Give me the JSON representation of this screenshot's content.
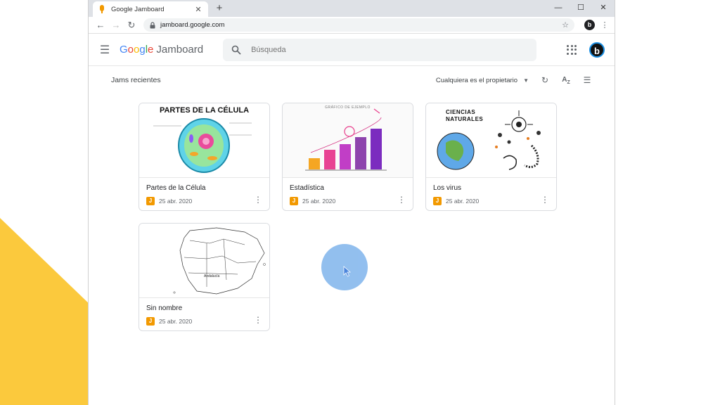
{
  "browser": {
    "tab_title": "Google Jamboard",
    "tab_close": "✕",
    "new_tab": "+",
    "url": "jamboard.google.com",
    "profile_initial": "b",
    "window_minimize": "—",
    "window_maximize": "☐",
    "window_close": "✕"
  },
  "header": {
    "logo_google": [
      "G",
      "o",
      "o",
      "g",
      "l",
      "e"
    ],
    "product": "Jamboard",
    "search_placeholder": "Búsqueda",
    "profile_initial": "b"
  },
  "toolbar": {
    "section_title": "Jams recientes",
    "owner_filter": "Cualquiera es el propietario"
  },
  "jams": [
    {
      "title": "Partes de la Célula",
      "date": "25 abr. 2020",
      "thumb_text": "PARTES DE LA CÉLULA"
    },
    {
      "title": "Estadística",
      "date": "25 abr. 2020",
      "thumb_text": "GRÁFICO DE EJEMPLO"
    },
    {
      "title": "Los virus",
      "date": "25 abr. 2020",
      "thumb_text": "CIENCIAS NATURALES"
    },
    {
      "title": "Sin nombre",
      "date": "25 abr. 2020",
      "thumb_text": "Andalucía"
    }
  ],
  "colors": {
    "accent_yellow": "#fbc93d",
    "jam_orange": "#f29900",
    "cursor_blue": "#7fb4ec"
  }
}
